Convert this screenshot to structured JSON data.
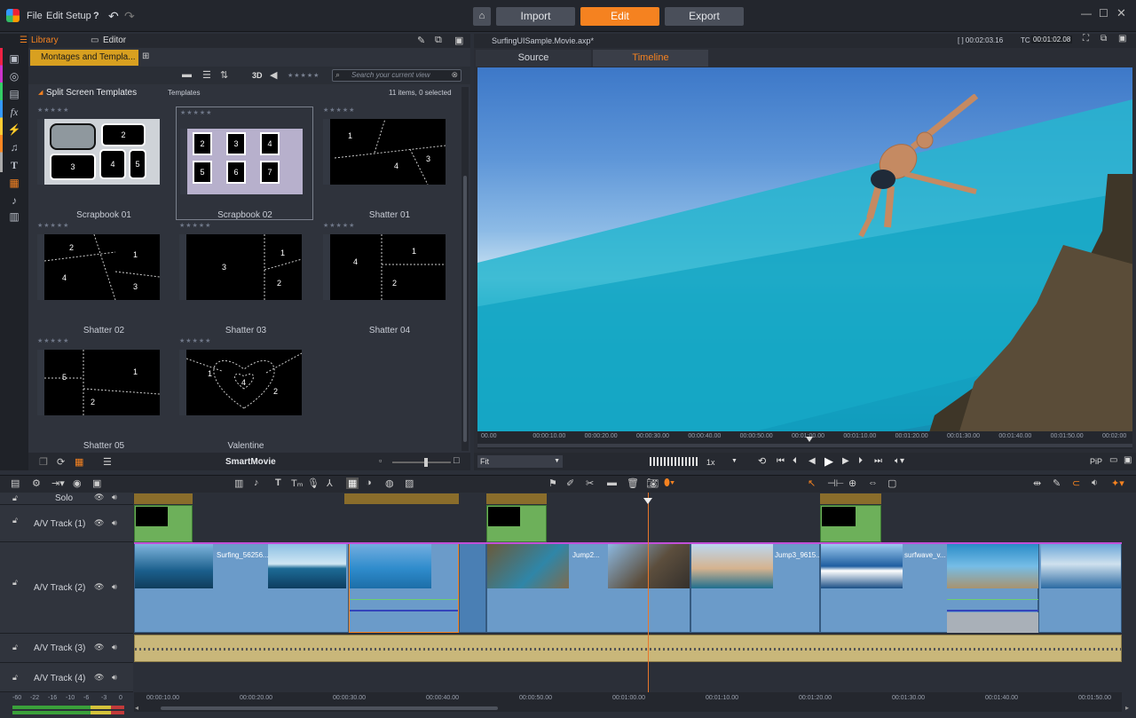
{
  "menu": {
    "file": "File",
    "edit": "Edit",
    "setup": "Setup"
  },
  "modes": {
    "import": "Import",
    "edit": "Edit",
    "export": "Export"
  },
  "library": {
    "tab_library": "Library",
    "tab_editor": "Editor",
    "collection": "Montages and Templa...",
    "view_3d": "3D",
    "search_placeholder": "Search your current view",
    "section_title": "Split Screen Templates",
    "section_sub": "Templates",
    "count": "11 items, 0 selected",
    "items": [
      "Scrapbook 01",
      "Scrapbook 02",
      "Shatter 01",
      "Shatter 02",
      "Shatter 03",
      "Shatter 04",
      "Shatter 05",
      "Valentine"
    ],
    "footer_label": "SmartMovie"
  },
  "player": {
    "file_name": "SurfingUISample.Movie.axp*",
    "duration": "[ ] 00:02:03.16",
    "tc_label": "TC",
    "timecode": "00:01:02.08",
    "tab_source": "Source",
    "tab_timeline": "Timeline",
    "zoom": "Fit",
    "speed": "1x",
    "pip": "PiP",
    "ruler": [
      "00.00",
      "00:00:10.00",
      "00:00:20.00",
      "00:00:30.00",
      "00:00:40.00",
      "00:00:50.00",
      "00:01:00.00",
      "00:01:10.00",
      "00:01:20.00",
      "00:01:30.00",
      "00:01:40.00",
      "00:01:50.00",
      "00:02:00"
    ]
  },
  "timeline": {
    "tracks": [
      "Solo",
      "A/V Track (1)",
      "A/V Track (2)",
      "A/V Track (3)",
      "A/V Track (4)"
    ],
    "clips": [
      "Surfing_56256...",
      "Jump2...",
      "Jump3_9615...",
      "surfwave_v..."
    ],
    "ruler": [
      "00:00:10.00",
      "00:00:20.00",
      "00:00:30.00",
      "00:00:40.00",
      "00:00:50.00",
      "00:01:00.00",
      "00:01:10.00",
      "00:01:20.00",
      "00:01:30.00",
      "00:01:40.00",
      "00:01:50.00"
    ],
    "meter": [
      "-60",
      "-22",
      "-16",
      "-10",
      "-6",
      "-3",
      "0"
    ]
  },
  "colors": {
    "accent": "#f58220",
    "clip": "#6b9bc9",
    "audio": "#c9b77a",
    "playhead": "#e8762b"
  }
}
